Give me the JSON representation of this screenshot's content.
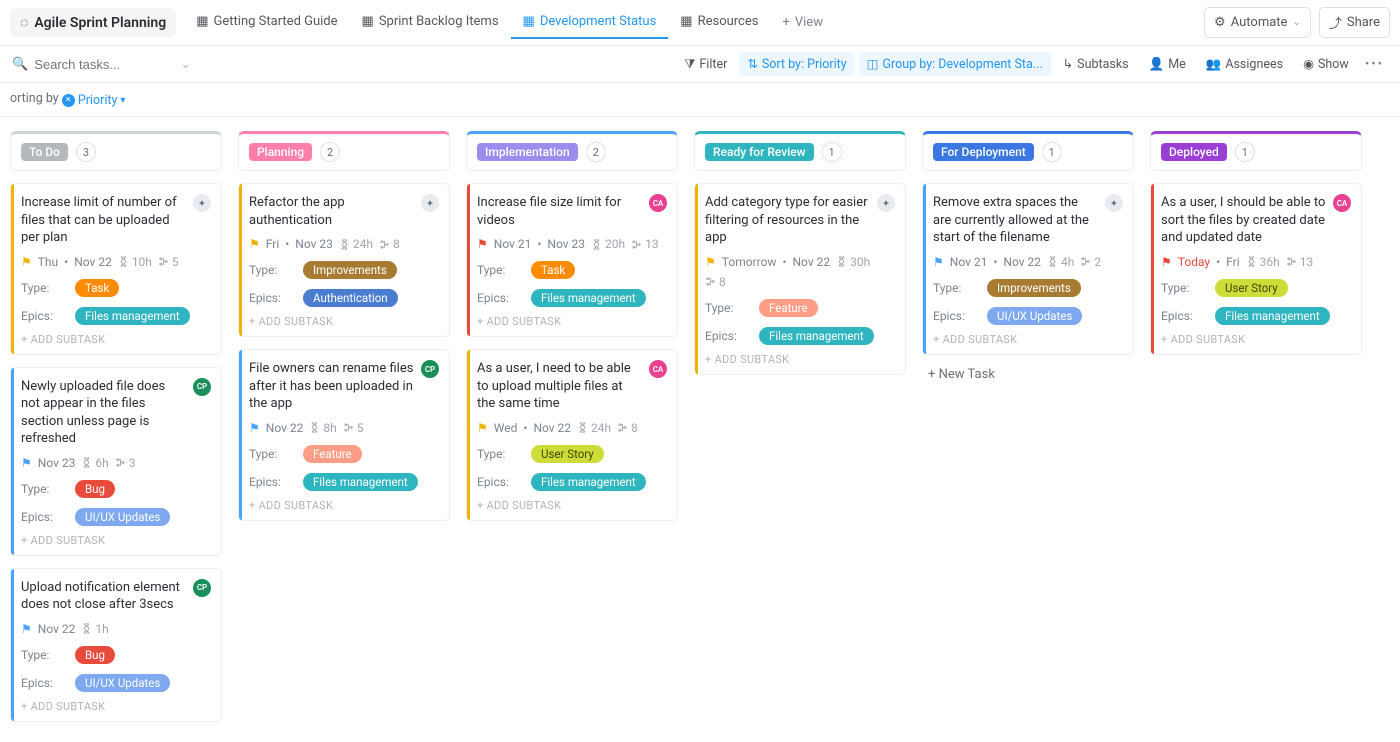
{
  "ws_title": "Agile Sprint Planning",
  "tabs": [
    {
      "label": "Getting Started Guide"
    },
    {
      "label": "Sprint Backlog Items"
    },
    {
      "label": "Development Status",
      "active": true
    },
    {
      "label": "Resources"
    }
  ],
  "add_view": "View",
  "automate": "Automate",
  "share": "Share",
  "search_placeholder": "Search tasks...",
  "toolbar": {
    "filter": "Filter",
    "sort": "Sort by: Priority",
    "group": "Group by: Development Sta...",
    "subtasks": "Subtasks",
    "me": "Me",
    "assignees": "Assignees",
    "show": "Show"
  },
  "sorting_label": "orting by",
  "sorting_value": "Priority",
  "addsub_label": "+ ADD SUBTASK",
  "newtask_label": "+ New Task",
  "field_labels": {
    "type": "Type:",
    "epics": "Epics:"
  },
  "tags": {
    "Task": "#ff8c00",
    "Bug": "#e84b3c",
    "Improvements": "#a87b32",
    "Feature": "#ff9d87",
    "User Story": "#cddc39",
    "Files management": "#2fb5bf",
    "Authentication": "#4a7ccf",
    "UI/UX Updates": "#7ea9f0"
  },
  "avatars": {
    "sprint": {
      "bg": "#e8ecf0",
      "fg": "#5f6b7a",
      "txt": "✦"
    },
    "cp": {
      "bg": "#1b8f5a",
      "fg": "#fff",
      "txt": "CP"
    },
    "ca": {
      "bg": "#e84291",
      "fg": "#fff",
      "txt": "CA"
    }
  },
  "flags": {
    "urgent": "#e84b3c",
    "high": "#f0b400",
    "normal": "#4aa3ff"
  },
  "columns": [
    {
      "name": "To Do",
      "count": 3,
      "color": "#b5b9bd",
      "top": "#cfd3d7",
      "cards": [
        {
          "ribbon": "#f0b400",
          "title": "Increase limit of number of files that can be uploaded per plan",
          "avatar": "sprint",
          "flag": "high",
          "date": "Thu",
          "due": "Nov 22",
          "est": "10h",
          "sub": "5",
          "type": "Task",
          "epics": "Files management"
        },
        {
          "ribbon": "#4aa3ff",
          "title": "Newly uploaded file does not appear in the files section unless page is refreshed",
          "avatar": "cp",
          "flag": "normal",
          "date": "Nov 23",
          "due": "",
          "est": "6h",
          "sub": "3",
          "type": "Bug",
          "epics": "UI/UX Updates"
        },
        {
          "ribbon": "#4aa3ff",
          "title": "Upload notification element does not close after 3secs",
          "avatar": "cp",
          "flag": "normal",
          "date": "Nov 22",
          "due": "",
          "est": "1h",
          "sub": "",
          "type": "Bug",
          "epics": "UI/UX Updates"
        }
      ]
    },
    {
      "name": "Planning",
      "count": 2,
      "color": "#ff7fab",
      "top": "#ff7fab",
      "cards": [
        {
          "ribbon": "#f0b400",
          "title": "Refactor the app authentication",
          "avatar": "sprint",
          "flag": "high",
          "date": "Fri",
          "due": "Nov 23",
          "est": "24h",
          "sub": "8",
          "type": "Improvements",
          "epics": "Authentication"
        },
        {
          "ribbon": "#4aa3ff",
          "title": "File owners can rename files after it has been uploaded in the app",
          "avatar": "cp",
          "flag": "normal",
          "date": "Nov 22",
          "due": "",
          "est": "8h",
          "sub": "5",
          "type": "Feature",
          "epics": "Files management"
        }
      ]
    },
    {
      "name": "Implementation",
      "count": 2,
      "color": "#9c8cf0",
      "top": "#4aa3ff",
      "cards": [
        {
          "ribbon": "#e84b3c",
          "title": "Increase file size limit for videos",
          "avatar": "ca",
          "flag": "urgent",
          "date": "Nov 21",
          "due": "Nov 23",
          "est": "20h",
          "sub": "13",
          "type": "Task",
          "epics": "Files management"
        },
        {
          "ribbon": "#f0b400",
          "title": "As a user, I need to be able to upload multiple files at the same time",
          "avatar": "ca",
          "flag": "high",
          "date": "Wed",
          "due": "Nov 22",
          "est": "24h",
          "sub": "8",
          "type": "User Story",
          "epics": "Files management"
        }
      ]
    },
    {
      "name": "Ready for Review",
      "count": 1,
      "color": "#2fb5bf",
      "top": "#2fb5bf",
      "cards": [
        {
          "ribbon": "#f0b400",
          "title": "Add category type for easier filtering of resources in the app",
          "avatar": "sprint",
          "flag": "high",
          "date": "Tomorrow",
          "due": "Nov 22",
          "est": "30h",
          "sub": "8",
          "type": "Feature",
          "epics": "Files management"
        }
      ]
    },
    {
      "name": "For Deployment",
      "count": 1,
      "color": "#3a77e0",
      "top": "#3a77e0",
      "cards": [
        {
          "ribbon": "#4aa3ff",
          "title": "Remove extra spaces the are currently allowed at the start of the filename",
          "avatar": "sprint",
          "flag": "normal",
          "date": "Nov 21",
          "due": "Nov 22",
          "est": "4h",
          "sub": "2",
          "type": "Improvements",
          "epics": "UI/UX Updates"
        }
      ],
      "show_newtask": true
    },
    {
      "name": "Deployed",
      "count": 1,
      "color": "#9b3fd4",
      "top": "#9b3fd4",
      "cards": [
        {
          "ribbon": "#e84b3c",
          "title": "As a user, I should be able to sort the files by created date and updated date",
          "avatar": "ca",
          "flag": "urgent",
          "date": "Today",
          "due": "Fri",
          "est": "36h",
          "sub": "13",
          "date_urgent": true,
          "type": "User Story",
          "epics": "Files management"
        }
      ]
    }
  ]
}
